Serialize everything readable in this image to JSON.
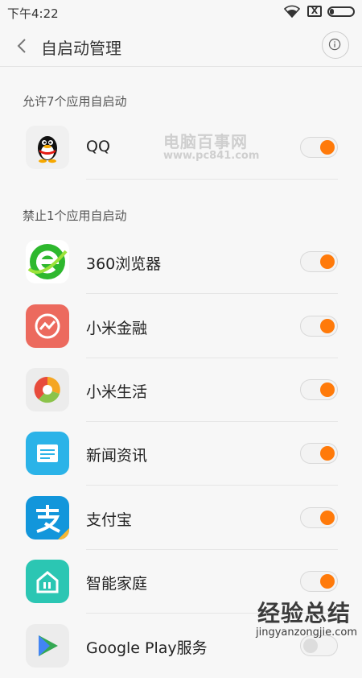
{
  "status_bar": {
    "time": "下午4:22",
    "sim_label": "X"
  },
  "header": {
    "title": "自启动管理"
  },
  "sections": {
    "allowed_title": "允许7个应用自启动",
    "blocked_title": "禁止1个应用自启动"
  },
  "apps": [
    {
      "name": "QQ",
      "icon": "qq-penguin-icon",
      "enabled": true
    },
    {
      "name": "360浏览器",
      "icon": "browser-360-icon",
      "enabled": true
    },
    {
      "name": "小米金融",
      "icon": "xiaomi-finance-icon",
      "enabled": true
    },
    {
      "name": "小米生活",
      "icon": "xiaomi-life-icon",
      "enabled": true
    },
    {
      "name": "新闻资讯",
      "icon": "news-icon",
      "enabled": true
    },
    {
      "name": "支付宝",
      "icon": "alipay-icon",
      "enabled": true
    },
    {
      "name": "智能家庭",
      "icon": "smart-home-icon",
      "enabled": true
    },
    {
      "name": "Google Play服务",
      "icon": "google-play-services-icon",
      "enabled": false
    }
  ],
  "watermarks": {
    "pc841_title": "电脑百事网",
    "pc841_url": "www.pc841.com",
    "jingyan_title": "经验总结",
    "jingyan_url": "jingyanzongjie.com"
  },
  "colors": {
    "toggle_on": "#ff7a0a",
    "background": "#f7f7f7"
  }
}
